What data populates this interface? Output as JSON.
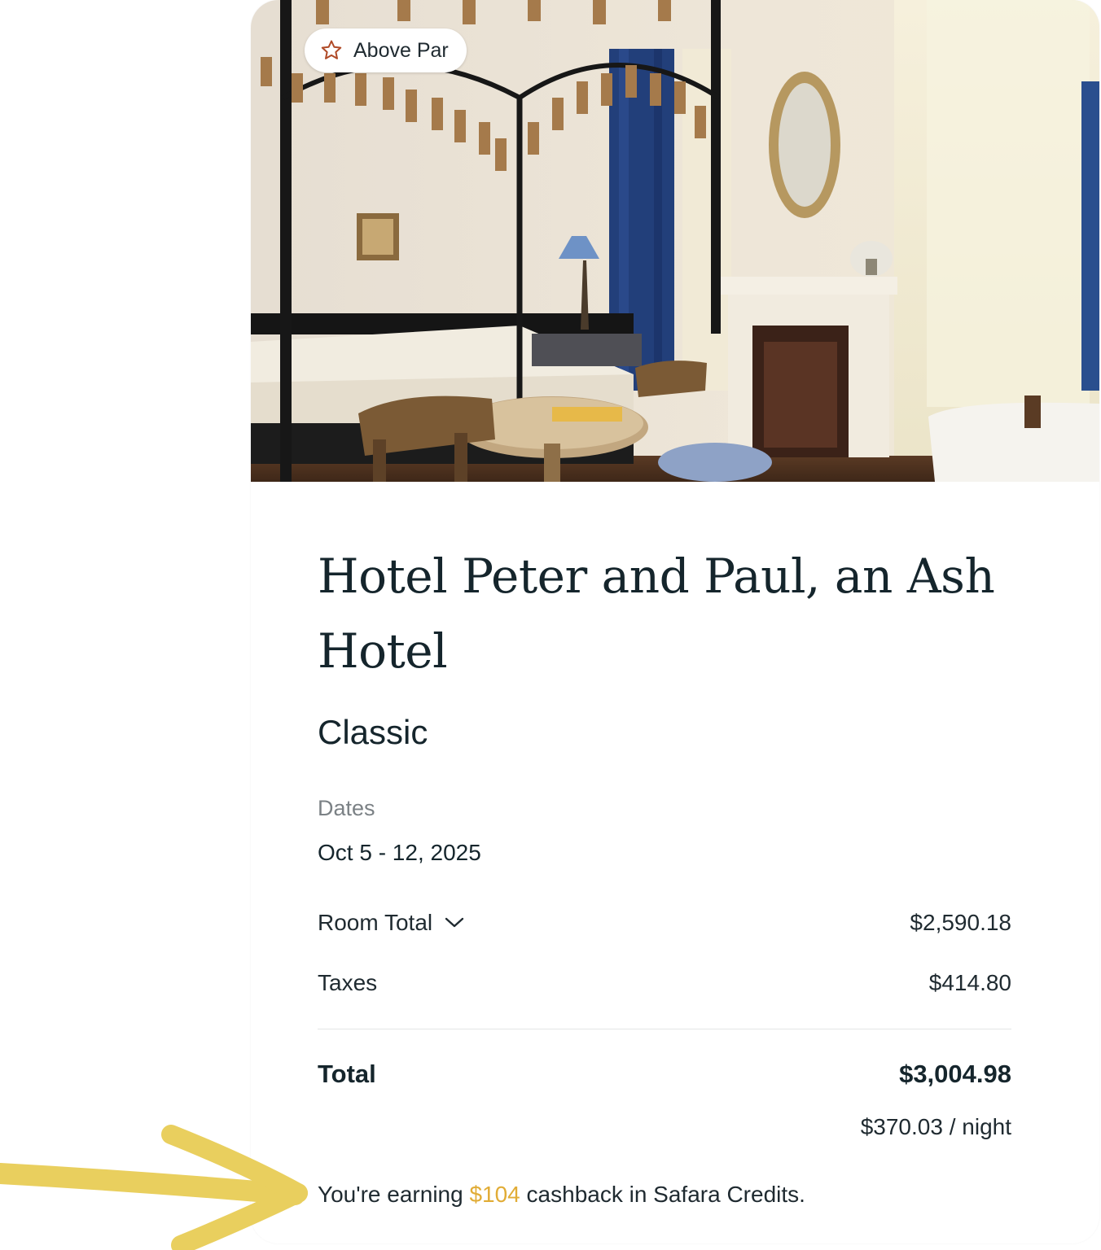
{
  "badge": {
    "icon": "star-icon",
    "label": "Above Par"
  },
  "hotel": {
    "name": "Hotel Peter and Paul, an Ash Hotel",
    "room_type": "Classic"
  },
  "dates": {
    "label": "Dates",
    "value": "Oct 5 - 12, 2025"
  },
  "pricing": {
    "room_total_label": "Room Total",
    "room_total_value": "$2,590.18",
    "taxes_label": "Taxes",
    "taxes_value": "$414.80",
    "total_label": "Total",
    "total_value": "$3,004.98",
    "per_night": "$370.03 / night"
  },
  "cashback": {
    "prefix": "You're earning ",
    "amount": "$104",
    "suffix": " cashback in Safara Credits."
  },
  "colors": {
    "accent_gold": "#e1ac36",
    "arrow": "#e9cf5e",
    "text_primary": "#15252c",
    "text_muted": "#7b8185"
  }
}
